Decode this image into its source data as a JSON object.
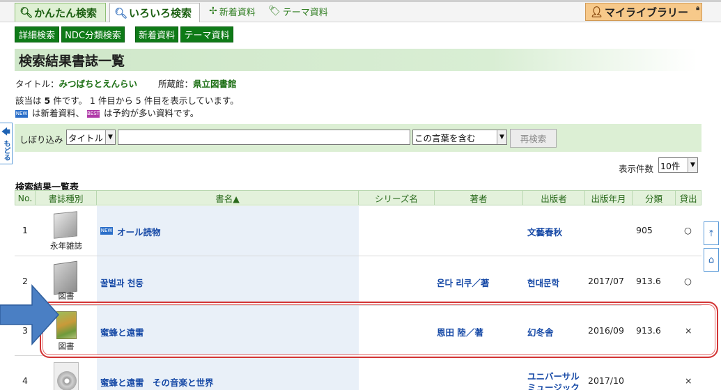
{
  "nav": {
    "simple_search": "かんたん検索",
    "various_search": "いろいろ検索",
    "new_materials": "新着資料",
    "theme_materials": "テーマ資料",
    "my_library": "マイライブラリー"
  },
  "subnav": {
    "detail_search": "詳細検索",
    "ndc_search": "NDC分類検索",
    "new_materials": "新着資料",
    "theme_materials": "テーマ資料"
  },
  "heading": "検索結果書誌一覧",
  "criteria": {
    "title_label": "タイトル：",
    "title_value": "みつばちとえんらい",
    "holding_label": "所蔵館：",
    "holding_value": "県立図書館"
  },
  "summary": {
    "prefix": "該当は",
    "count": "5",
    "suffix": "件です。 1 件目から 5 件目を表示しています。"
  },
  "legend": {
    "new_badge": "NEW",
    "new_text": "は新着資料、",
    "best_badge": "BEST",
    "best_text": "は予約が多い資料です。"
  },
  "back_tab": "もどる",
  "filter": {
    "label": "しぼり込み",
    "field_value": "タイトル",
    "keyword_value": "",
    "match_value": "この言葉を含む",
    "research_button": "再検索"
  },
  "per_page": {
    "label": "表示件数",
    "value": "10件"
  },
  "table_title": "検索結果一覧表",
  "columns": [
    "No.",
    "書誌種別",
    "書名▲",
    "シリーズ名",
    "著者",
    "出版者",
    "出版年月",
    "分類",
    "貸出"
  ],
  "rows": [
    {
      "no": "1",
      "type": "永年雑誌",
      "new": true,
      "title": "オール読物",
      "series": "",
      "author": "",
      "publisher": "文藝春秋",
      "date": "",
      "class": "905",
      "loan": "○"
    },
    {
      "no": "2",
      "type": "図書",
      "new": false,
      "title": "꿀벌과 천둥",
      "series": "",
      "author": "온다 리쿠／著",
      "publisher": "현대문학",
      "date": "2017/07",
      "class": "913.6",
      "loan": "○"
    },
    {
      "no": "3",
      "type": "図書",
      "new": false,
      "title": "蜜蜂と遠雷",
      "series": "",
      "author": "恩田 陸／著",
      "publisher": "幻冬舎",
      "date": "2016/09",
      "class": "913.6",
      "loan": "×"
    },
    {
      "no": "4",
      "type": "",
      "new": false,
      "title": "蜜蜂と遠雷　その音楽と世界",
      "series": "",
      "author": "",
      "publisher_line1": "ユニバーサル",
      "publisher_line2": "ミュージック",
      "date": "2017/10",
      "class": "",
      "loan": "×"
    }
  ],
  "colors": {
    "accent_green": "#0e7a17",
    "link_blue": "#1649a6",
    "highlight_red": "#d23434",
    "annotation_arrow": "#4a7fc4"
  }
}
